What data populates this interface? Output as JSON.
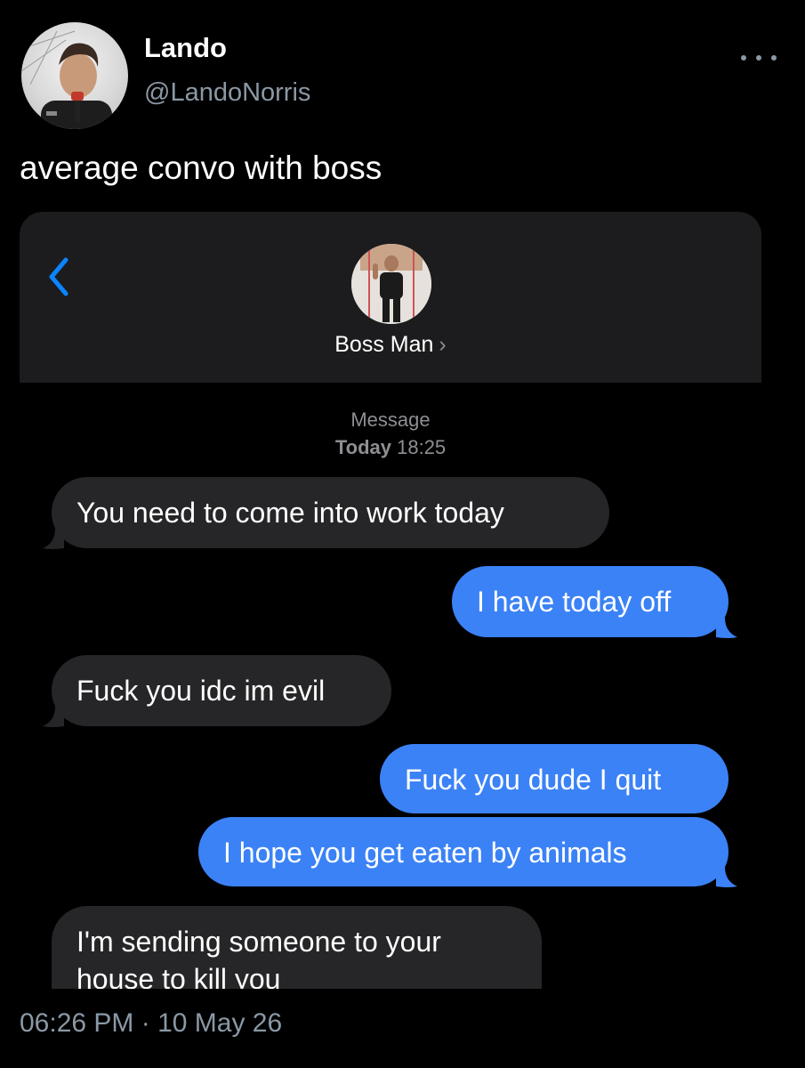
{
  "tweet": {
    "display_name": "Lando",
    "handle": "@LandoNorris",
    "text": "average convo with boss",
    "timestamp": "06:26 PM · 10 May 26"
  },
  "imessage": {
    "contact_name": "Boss Man",
    "chevron": "›",
    "service_label": "Message",
    "date_bold": "Today",
    "time": "18:25",
    "messages": [
      {
        "direction": "incoming",
        "text": "You need to come into work today"
      },
      {
        "direction": "outgoing",
        "text": "I have today off"
      },
      {
        "direction": "incoming",
        "text": "Fuck you idc im evil"
      },
      {
        "direction": "outgoing",
        "text": "Fuck you dude I quit"
      },
      {
        "direction": "outgoing",
        "text": "I hope you get eaten by animals"
      },
      {
        "direction": "incoming",
        "text": "I'm sending someone to your house to kill you"
      }
    ]
  },
  "colors": {
    "outgoing_bubble": "#3b82f6",
    "incoming_bubble": "#262628",
    "accent_link": "#0a84ff",
    "secondary_text": "#8b98a5"
  },
  "icons": [
    "more-options-icon",
    "back-chevron-icon"
  ]
}
